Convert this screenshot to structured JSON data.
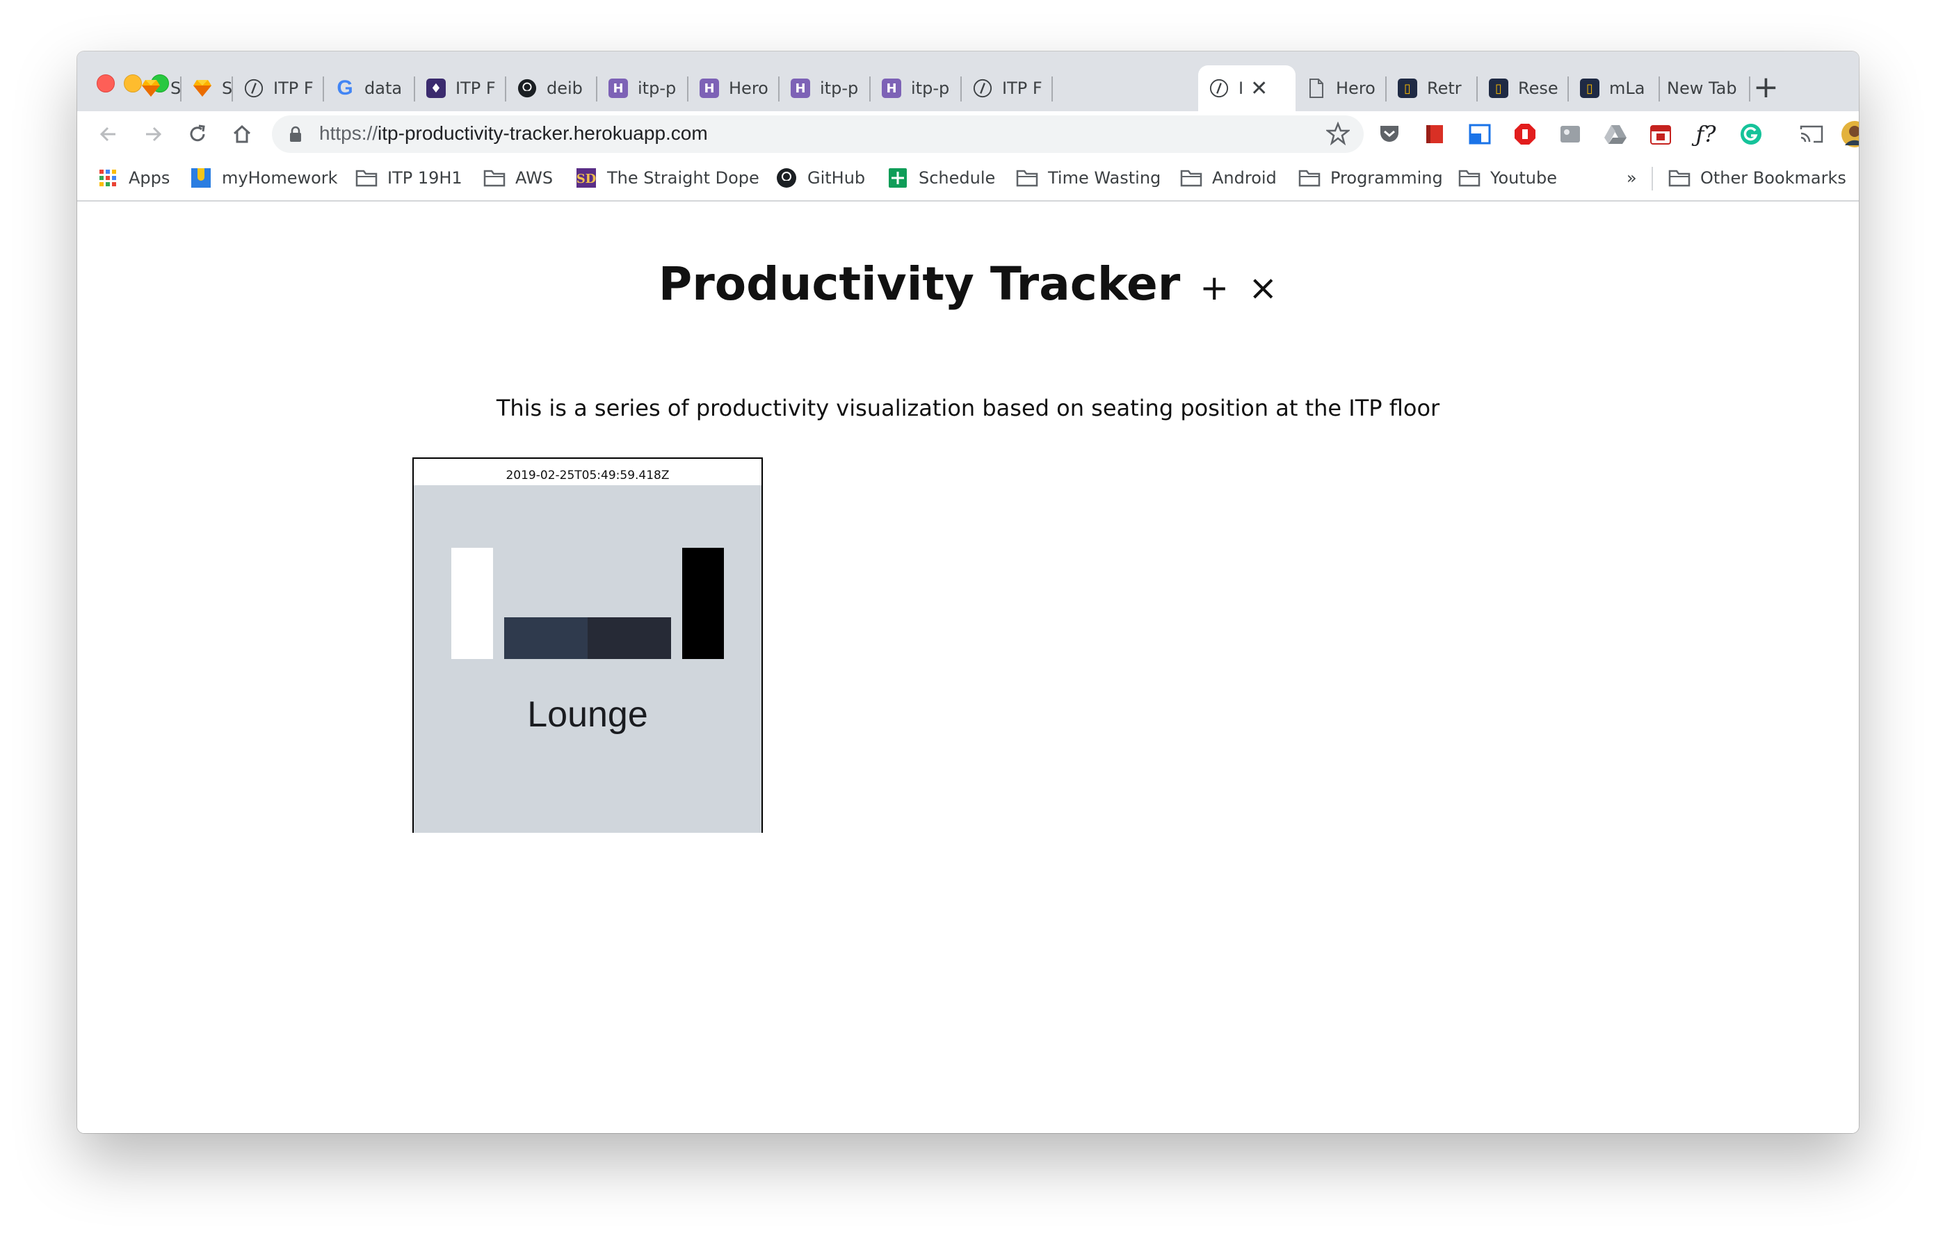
{
  "browser": {
    "tabs": [
      {
        "label": "Sket",
        "icon": "sketch-icon"
      },
      {
        "label": "Sket",
        "icon": "sketch-icon"
      },
      {
        "label": "ITP F",
        "icon": "itp-icon"
      },
      {
        "label": "data",
        "icon": "google-icon"
      },
      {
        "label": "ITP F",
        "icon": "itp-purple-icon"
      },
      {
        "label": "deib",
        "icon": "github-icon"
      },
      {
        "label": "itp-p",
        "icon": "heroku-icon"
      },
      {
        "label": "Hero",
        "icon": "heroku-icon"
      },
      {
        "label": "itp-p",
        "icon": "heroku-icon"
      },
      {
        "label": "itp-p",
        "icon": "heroku-icon"
      },
      {
        "label": "ITP F",
        "icon": "itp-icon"
      },
      {
        "label": "I",
        "icon": "itp-icon",
        "active": true
      },
      {
        "label": "Hero",
        "icon": "page-icon"
      },
      {
        "label": "Retr",
        "icon": "mlab-icon"
      },
      {
        "label": "Rese",
        "icon": "mlab-icon"
      },
      {
        "label": "mLa",
        "icon": "mlab-icon"
      },
      {
        "label": "New Tab",
        "icon": ""
      }
    ],
    "newtab_symbol": "+",
    "close_symbol": "✕",
    "url_scheme": "https://",
    "url_host": "itp-productivity-tracker.herokuapp.com",
    "bookmarks": [
      {
        "label": "Apps",
        "icon": "apps-grid-icon"
      },
      {
        "label": "myHomework",
        "icon": "myhomework-icon"
      },
      {
        "label": "ITP 19H1",
        "icon": "folder-icon"
      },
      {
        "label": "AWS",
        "icon": "folder-icon"
      },
      {
        "label": "The Straight Dope",
        "icon": "straight-dope-icon"
      },
      {
        "label": "GitHub",
        "icon": "github-icon"
      },
      {
        "label": "Schedule",
        "icon": "sheets-icon"
      },
      {
        "label": "Time Wasting",
        "icon": "folder-icon"
      },
      {
        "label": "Android",
        "icon": "folder-icon"
      },
      {
        "label": "Programming",
        "icon": "folder-icon"
      },
      {
        "label": "Youtube",
        "icon": "folder-icon"
      }
    ],
    "bookmarks_overflow": "»",
    "other_bookmarks": "Other Bookmarks"
  },
  "page": {
    "title": "Productivity Tracker",
    "add_symbol": "+",
    "remove_symbol": "×",
    "subtitle": "This is a series of productivity visualization based on seating position at the ITP floor",
    "cards": [
      {
        "timestamp": "2019-02-25T05:49:59.418Z",
        "location": "Lounge"
      }
    ]
  },
  "colors": {
    "card_background": "#d0d6dc",
    "bar_white": "#ffffff",
    "bar_slate": "#2f3a4d",
    "bar_dark": "#262a36",
    "bar_black": "#000000"
  }
}
